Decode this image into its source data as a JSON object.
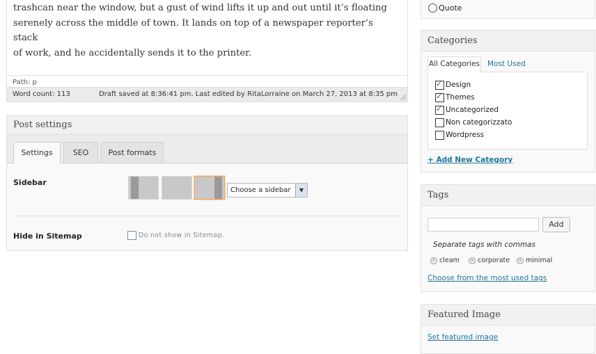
{
  "editor": {
    "paragraph_lines": [
      "trashcan near the window, but a gust of wind lifts it up and out until it’s floating",
      "serenely across the middle of town. It lands on top of a newspaper reporter’s stack",
      "of work, and he accidentally sends it to the printer."
    ],
    "path_text": "Path: p",
    "word_count": "Word count: 113",
    "draft_status": "Draft saved at 8:36:41 pm. Last edited by RitaLorraine on March 27, 2013 at 8:35 pm"
  },
  "post_settings": {
    "title": "Post settings",
    "tabs": [
      "Settings",
      "SEO",
      "Post formats"
    ],
    "sidebar_label": "Sidebar",
    "sidebar_select_value": "Choose a sidebar",
    "hide_sitemap_label": "Hide in Sitemap",
    "hide_sitemap_note": "Do not show in Sitemap."
  },
  "format": {
    "quote_label": "Quote"
  },
  "categories": {
    "title": "Categories",
    "tab_all": "All Categories",
    "tab_most_used": "Most Used",
    "items": [
      {
        "label": "Design",
        "checked": true
      },
      {
        "label": "Themes",
        "checked": true
      },
      {
        "label": "Uncategorized",
        "checked": true
      },
      {
        "label": "Non categorizzato",
        "checked": false
      },
      {
        "label": "Wordpress",
        "checked": false
      }
    ],
    "add_new": "+ Add New Category"
  },
  "tags": {
    "title": "Tags",
    "add_button": "Add",
    "hint": "Separate tags with commas",
    "chips": [
      "cleam",
      "corporate",
      "minimal"
    ],
    "choose_link": "Choose from the most used tags"
  },
  "featured_image": {
    "title": "Featured Image",
    "set_link": "Set featured image"
  },
  "colors": {
    "link": "#21759b",
    "selected_layout_border": "#f7a35c",
    "checkbox_tick": "#1a7a1a"
  }
}
